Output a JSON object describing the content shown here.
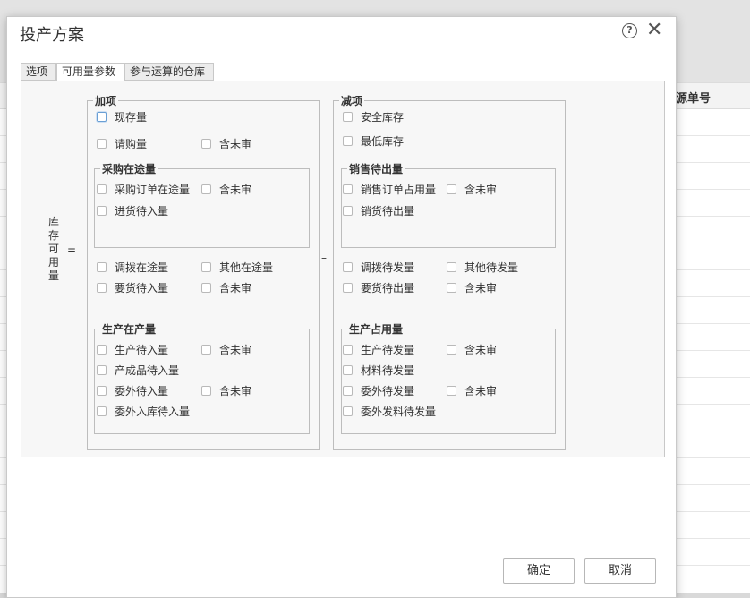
{
  "background": {
    "left_fragment": "",
    "column_header": "源单号"
  },
  "dialog": {
    "title": "投产方案",
    "help_icon": "?",
    "close_icon": "✕",
    "tabs": [
      {
        "label": "选项",
        "active": false
      },
      {
        "label": "可用量参数",
        "active": true
      },
      {
        "label": "参与运算的仓库",
        "active": false
      }
    ],
    "formula": {
      "left_label": "库存可用量",
      "equals": "=",
      "minus": "–"
    },
    "add_group": {
      "legend": "加项",
      "stock": "现存量",
      "purchase_req": "请购量",
      "purchase_req_unaudited": "含未审",
      "in_transit": {
        "legend": "采购在途量",
        "po_in_transit": "采购订单在途量",
        "po_unaudited": "含未审",
        "receipt_pending": "进货待入量"
      },
      "transfer_in_transit": "调拨在途量",
      "other_in_transit": "其他在途量",
      "requisition_pending": "要货待入量",
      "requisition_unaudited": "含未审",
      "production": {
        "legend": "生产在产量",
        "prod_pending_in": "生产待入量",
        "prod_unaudited": "含未审",
        "product_pending_in": "产成品待入量",
        "outsource_pending_in": "委外待入量",
        "outsource_unaudited": "含未审",
        "outsource_storage_pending": "委外入库待入量"
      }
    },
    "sub_group": {
      "legend": "减项",
      "safety_stock": "安全库存",
      "min_stock": "最低库存",
      "sales_out": {
        "legend": "销售待出量",
        "so_occupied": "销售订单占用量",
        "so_unaudited": "含未审",
        "delivery_pending": "销货待出量"
      },
      "transfer_pending_out": "调拨待发量",
      "other_pending_out": "其他待发量",
      "requisition_pending_out": "要货待出量",
      "requisition_unaudited": "含未审",
      "production_use": {
        "legend": "生产占用量",
        "prod_pending_issue": "生产待发量",
        "prod_unaudited": "含未审",
        "material_pending_issue": "材料待发量",
        "outsource_pending_issue": "委外待发量",
        "outsource_unaudited": "含未审",
        "outsource_material_pending": "委外发料待发量"
      }
    },
    "buttons": {
      "ok": "确定",
      "cancel": "取消"
    }
  }
}
